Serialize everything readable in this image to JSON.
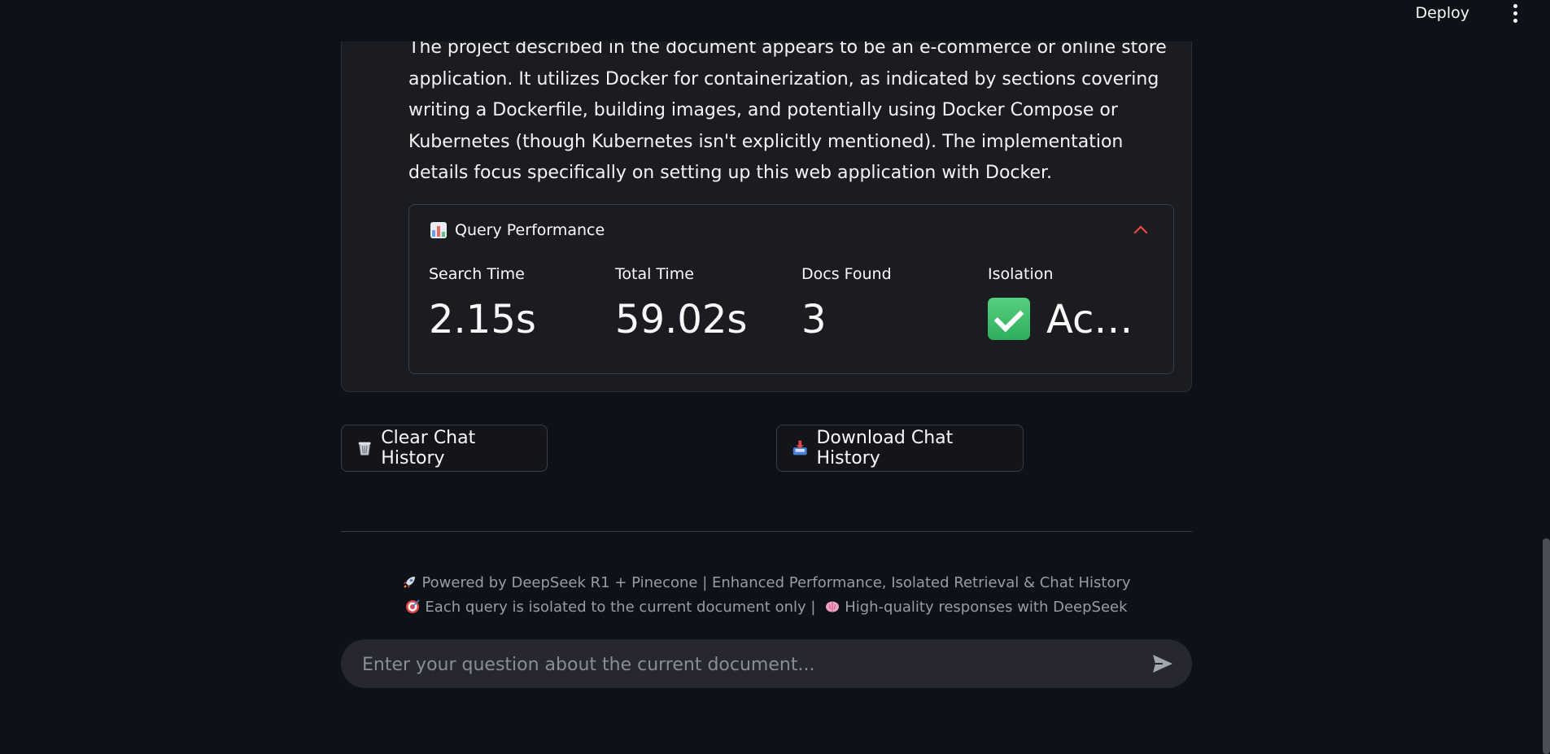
{
  "header": {
    "deploy_label": "Deploy"
  },
  "message": {
    "text": "The project described in the document appears to be an e-commerce or online store application. It utilizes Docker for containerization, as indicated by sections covering writing a Dockerfile, building images, and potentially using Docker Compose or Kubernetes (though Kubernetes isn't explicitly mentioned). The implementation details focus specifically on setting up this web application with Docker."
  },
  "performance": {
    "title": "Query Performance",
    "icon": "bar-chart-icon",
    "metrics": [
      {
        "label": "Search Time",
        "value": "2.15s"
      },
      {
        "label": "Total Time",
        "value": "59.02s"
      },
      {
        "label": "Docs Found",
        "value": "3"
      },
      {
        "label": "Isolation",
        "value": "Ac…",
        "icon": "check-mark-icon"
      }
    ]
  },
  "buttons": {
    "clear": {
      "label": "Clear Chat History",
      "icon": "wastebasket-icon"
    },
    "download": {
      "label": "Download Chat History",
      "icon": "inbox-tray-icon"
    }
  },
  "footer": {
    "line1": "Powered by DeepSeek R1 + Pinecone | Enhanced Performance, Isolated Retrieval & Chat History",
    "line2_part1": "Each query is isolated to the current document only |",
    "line2_part2": "High-quality responses with DeepSeek"
  },
  "chat_input": {
    "placeholder": "Enter your question about the current document..."
  },
  "colors": {
    "background": "#0e1117",
    "card": "#1b1c21",
    "accent": "#ff4b4b",
    "muted_text": "#9a9ca3"
  }
}
